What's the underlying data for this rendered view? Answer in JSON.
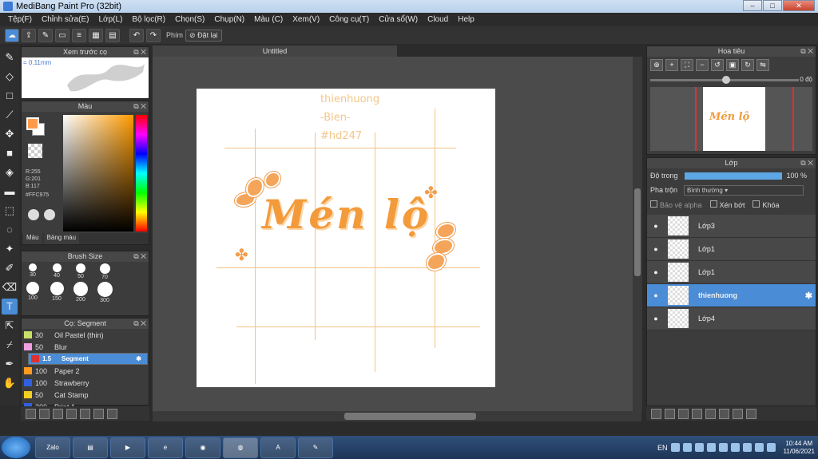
{
  "window": {
    "title": "MediBang Paint Pro (32bit)",
    "min": "–",
    "max": "□",
    "close": "✕"
  },
  "menu": [
    "Tệp(F)",
    "Chỉnh sửa(E)",
    "Lớp(L)",
    "Bộ lọc(R)",
    "Chọn(S)",
    "Chụp(N)",
    "Màu (C)",
    "Xem(V)",
    "Công cụ(T)",
    "Cửa sổ(W)",
    "Cloud",
    "Help"
  ],
  "toolbar": {
    "shortcut_label": "Phím",
    "reset_label": "Đặt lại"
  },
  "brush_preview": {
    "title": "Xem trước cọ",
    "size": "0.11mm"
  },
  "color_panel": {
    "title": "Màu",
    "r": "R:255",
    "g": "G:201",
    "b": "B:117",
    "hex": "#FFC975",
    "tab_color": "Màu",
    "tab_palette": "Bảng màu",
    "fg_color": "#ff9a4b"
  },
  "brush_size": {
    "title": "Brush Size",
    "sizes": [
      "30",
      "40",
      "50",
      "70",
      "100",
      "150",
      "200",
      "300"
    ]
  },
  "brush_list": {
    "title": "Cọ: Segment",
    "items": [
      {
        "num": "30",
        "name": "Oil Pastel (thin)",
        "color": "#c8e06a"
      },
      {
        "num": "50",
        "name": "Blur",
        "color": "#f0a0e0"
      },
      {
        "num": "1.5",
        "name": "Segment",
        "color": "#e03030"
      },
      {
        "num": "100",
        "name": "Paper 2",
        "color": "#ff9a20"
      },
      {
        "num": "100",
        "name": "Strawberry",
        "color": "#3060e0"
      },
      {
        "num": "50",
        "name": "Cat Stamp",
        "color": "#f0d020"
      },
      {
        "num": "200",
        "name": "Print 1",
        "color": "#3060e0"
      }
    ]
  },
  "document": {
    "tab": "Untitled",
    "signature": [
      "thienhuong",
      "-Blen-",
      "#hd247"
    ],
    "title_text": "Mén lộ"
  },
  "navigator": {
    "title": "Hoa tiêu",
    "angle": "0 độ"
  },
  "layer_panel": {
    "title": "Lớp",
    "opacity_label": "Độ trong",
    "opacity_value": "100 %",
    "opacity": 1.0,
    "blend_label": "Pha trộn",
    "blend_value": "Bình thường",
    "protect_alpha": "Bảo vệ alpha",
    "clipping": "Xén bớt",
    "lock": "Khóa",
    "layers": [
      {
        "name": "Lớp3",
        "active": false
      },
      {
        "name": "Lớp1",
        "active": false
      },
      {
        "name": "Lớp1",
        "active": false
      },
      {
        "name": "thienhuong",
        "active": true
      },
      {
        "name": "Lớp4",
        "active": false
      }
    ]
  },
  "taskbar": {
    "apps": [
      "Zalo",
      "",
      "",
      "",
      "",
      "",
      "",
      ""
    ],
    "lang": "EN",
    "time": "10:44 AM",
    "date": "11/06/2021"
  }
}
